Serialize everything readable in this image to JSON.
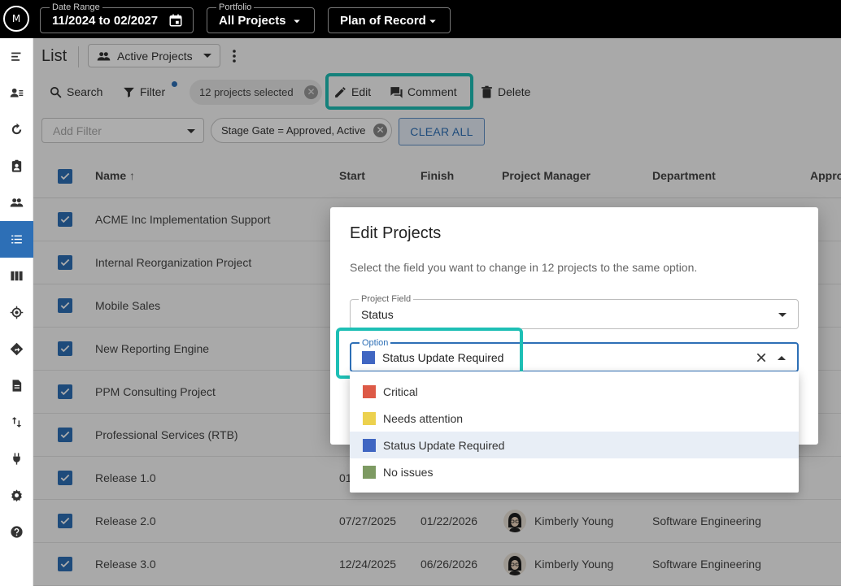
{
  "topbar": {
    "logo": "M",
    "date_range": {
      "label": "Date Range",
      "value": "11/2024 to 02/2027"
    },
    "portfolio": {
      "label": "Portfolio",
      "value": "All Projects"
    },
    "scenario": {
      "value": "Plan of Record"
    }
  },
  "header": {
    "title": "List",
    "view": "Active Projects"
  },
  "toolbar": {
    "search": "Search",
    "filter": "Filter",
    "selected": "12 projects selected",
    "edit": "Edit",
    "comment": "Comment",
    "delete": "Delete"
  },
  "filters": {
    "add_placeholder": "Add Filter",
    "chip": "Stage Gate = Approved, Active",
    "clear_all": "CLEAR ALL"
  },
  "table": {
    "columns": [
      "Name",
      "Start",
      "Finish",
      "Project Manager",
      "Department",
      "Appro"
    ],
    "rows": [
      {
        "name": "ACME Inc Implementation Support",
        "start": "",
        "finish": "",
        "pm": "",
        "dept": ""
      },
      {
        "name": "Internal Reorganization Project",
        "start": "",
        "finish": "",
        "pm": "",
        "dept": ""
      },
      {
        "name": "Mobile Sales",
        "start": "",
        "finish": "",
        "pm": "",
        "dept": ""
      },
      {
        "name": "New Reporting Engine",
        "start": "",
        "finish": "",
        "pm": "",
        "dept": ""
      },
      {
        "name": "PPM Consulting Project",
        "start": "",
        "finish": "",
        "pm": "",
        "dept": ""
      },
      {
        "name": "Professional Services (RTB)",
        "start": "",
        "finish": "",
        "pm": "",
        "dept": ""
      },
      {
        "name": "Release 1.0",
        "start": "01",
        "finish": "",
        "pm": "",
        "dept": ""
      },
      {
        "name": "Release 2.0",
        "start": "07/27/2025",
        "finish": "01/22/2026",
        "pm": "Kimberly Young",
        "dept": "Software Engineering"
      },
      {
        "name": "Release 3.0",
        "start": "12/24/2025",
        "finish": "06/26/2026",
        "pm": "Kimberly Young",
        "dept": "Software Engineering"
      }
    ]
  },
  "dialog": {
    "title": "Edit Projects",
    "description": "Select the field you want to change in 12 projects to the same option.",
    "field_label": "Project Field",
    "field_value": "Status",
    "option_label": "Option",
    "option_value": "Status Update Required",
    "option_color": "#4066c2",
    "options": [
      {
        "label": "Critical",
        "color": "#dd5a47"
      },
      {
        "label": "Needs attention",
        "color": "#ecd14e"
      },
      {
        "label": "Status Update Required",
        "color": "#4066c2"
      },
      {
        "label": "No issues",
        "color": "#7d9a62"
      }
    ]
  },
  "colors": {
    "accent": "#2d6fb6",
    "highlight": "#1ebfb5",
    "topbar": "#000000"
  }
}
